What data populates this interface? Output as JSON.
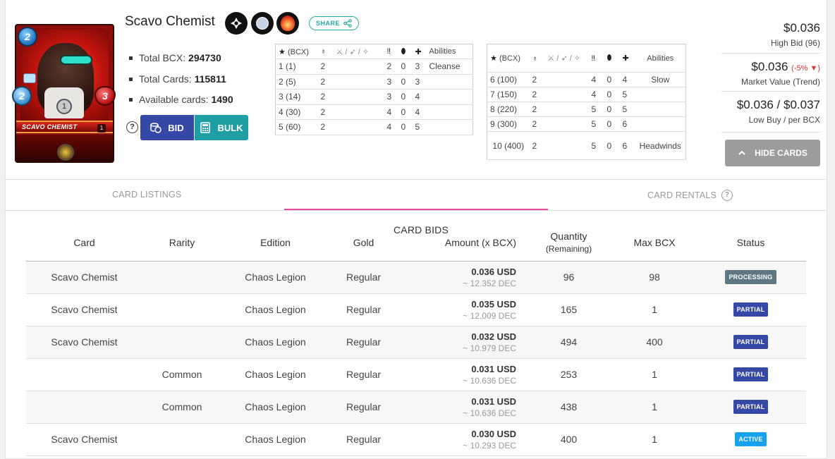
{
  "card": {
    "name": "Scavo Chemist",
    "art_name": "SCAVO CHEMIST",
    "art_level": "1",
    "mana": "2",
    "ranged": "2",
    "health": "3",
    "speed": "1"
  },
  "badges": {
    "edition_icon": "chaos-legion-icon",
    "rarity_icon": "common-rarity-icon",
    "element_icon": "fire-element-icon"
  },
  "share_label": "SHARE",
  "stats": {
    "total_bcx_label": "Total BCX:",
    "total_bcx": "294730",
    "total_cards_label": "Total Cards:",
    "total_cards": "115811",
    "available_label": "Available cards:",
    "available": "1490"
  },
  "buttons": {
    "help": "?",
    "bid": "BID",
    "bulk": "BULK",
    "hide_cards": "HIDE CARDS"
  },
  "level_table": {
    "headers": {
      "bcx": "(BCX)",
      "speed_icon": "speed-icon",
      "attack_icons": "melee / ranged / magic",
      "abilities": "Abilities"
    },
    "left_rows": [
      {
        "lvl": "1 (1)",
        "a": "2",
        "s": "2",
        "arm": "0",
        "hp": "3",
        "ab": "Cleanse"
      },
      {
        "lvl": "2 (5)",
        "a": "2",
        "s": "3",
        "arm": "0",
        "hp": "3",
        "ab": ""
      },
      {
        "lvl": "3 (14)",
        "a": "2",
        "s": "3",
        "arm": "0",
        "hp": "4",
        "ab": ""
      },
      {
        "lvl": "4 (30)",
        "a": "2",
        "s": "4",
        "arm": "0",
        "hp": "4",
        "ab": ""
      },
      {
        "lvl": "5 (60)",
        "a": "2",
        "s": "4",
        "arm": "0",
        "hp": "5",
        "ab": ""
      }
    ],
    "right_rows": [
      {
        "lvl": "6 (100)",
        "a": "2",
        "s": "4",
        "arm": "0",
        "hp": "4",
        "ab": "Slow"
      },
      {
        "lvl": "7 (150)",
        "a": "2",
        "s": "4",
        "arm": "0",
        "hp": "5",
        "ab": ""
      },
      {
        "lvl": "8 (220)",
        "a": "2",
        "s": "5",
        "arm": "0",
        "hp": "5",
        "ab": ""
      },
      {
        "lvl": "9 (300)",
        "a": "2",
        "s": "5",
        "arm": "0",
        "hp": "6",
        "ab": ""
      },
      {
        "lvl": "10 (400)",
        "a": "2",
        "s": "5",
        "arm": "0",
        "hp": "6",
        "ab": "Headwinds"
      }
    ]
  },
  "prices": {
    "high_bid": "$0.036",
    "high_bid_label": "High Bid (96)",
    "market_value": "$0.036",
    "trend": "(-5%",
    "trend_close": ")",
    "market_label": "Market Value (Trend)",
    "low_buy": "$0.036 / $0.037",
    "low_buy_label": "Low Buy / per BCX"
  },
  "tabs": {
    "listings": "CARD LISTINGS",
    "bids": "CARD BIDS",
    "rentals": "CARD RENTALS"
  },
  "bids_table": {
    "headers": {
      "card": "Card",
      "rarity": "Rarity",
      "edition": "Edition",
      "gold": "Gold",
      "amount": "Amount (x BCX)",
      "quantity": "Quantity",
      "quantity_sub": "(Remaining)",
      "max_bcx": "Max BCX",
      "status": "Status"
    },
    "rows": [
      {
        "card": "Scavo Chemist",
        "rarity": "",
        "edition": "Chaos Legion",
        "gold": "Regular",
        "usd": "0.036 USD",
        "dec": "~ 12.352 DEC",
        "qty": "96",
        "max": "98",
        "status": "PROCESSING"
      },
      {
        "card": "Scavo Chemist",
        "rarity": "",
        "edition": "Chaos Legion",
        "gold": "Regular",
        "usd": "0.035 USD",
        "dec": "~ 12.009 DEC",
        "qty": "165",
        "max": "1",
        "status": "PARTIAL"
      },
      {
        "card": "Scavo Chemist",
        "rarity": "",
        "edition": "Chaos Legion",
        "gold": "Regular",
        "usd": "0.032 USD",
        "dec": "~ 10.979 DEC",
        "qty": "494",
        "max": "400",
        "status": "PARTIAL"
      },
      {
        "card": "",
        "rarity": "Common",
        "edition": "Chaos Legion",
        "gold": "Regular",
        "usd": "0.031 USD",
        "dec": "~ 10.636 DEC",
        "qty": "253",
        "max": "1",
        "status": "PARTIAL"
      },
      {
        "card": "",
        "rarity": "Common",
        "edition": "Chaos Legion",
        "gold": "Regular",
        "usd": "0.031 USD",
        "dec": "~ 10.636 DEC",
        "qty": "438",
        "max": "1",
        "status": "PARTIAL"
      },
      {
        "card": "Scavo Chemist",
        "rarity": "",
        "edition": "Chaos Legion",
        "gold": "Regular",
        "usd": "0.030 USD",
        "dec": "~ 10.293 DEC",
        "qty": "400",
        "max": "1",
        "status": "ACTIVE"
      }
    ]
  },
  "colors": {
    "bid_button": "#3548a6",
    "bulk_button": "#1f9ea3",
    "tab_accent": "#e24a9a",
    "processing": "#5e7783",
    "partial": "#3548a6",
    "active": "#17a2f0"
  }
}
